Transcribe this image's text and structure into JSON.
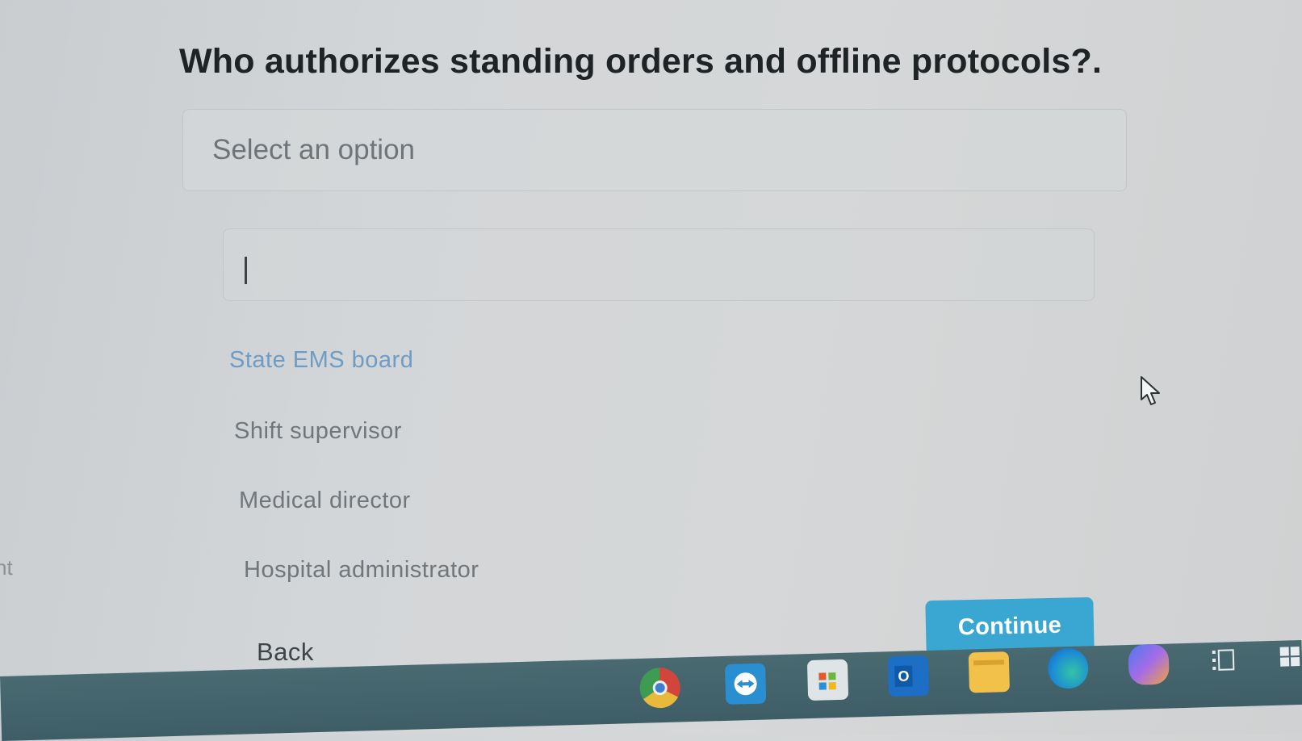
{
  "question": {
    "title": "Who authorizes standing orders and offline protocols?."
  },
  "select": {
    "placeholder": "Select an option"
  },
  "search": {
    "value": ""
  },
  "options": [
    {
      "label": "State EMS board",
      "highlighted": true
    },
    {
      "label": "Shift supervisor",
      "highlighted": false
    },
    {
      "label": "Medical director",
      "highlighted": false
    },
    {
      "label": "Hospital administrator",
      "highlighted": false
    }
  ],
  "navigation": {
    "back_label": "Back",
    "continue_label": "Continue"
  },
  "side_fragment": "nt",
  "colors": {
    "accent": "#3aa6d2",
    "highlight_option": "#6f9cc2",
    "taskbar": "#44636b"
  },
  "taskbar": {
    "icons": [
      "chrome-icon",
      "teamviewer-icon",
      "store-icon",
      "outlook-icon",
      "file-explorer-icon",
      "edge-icon",
      "copilot-icon",
      "task-view-icon",
      "windows-start-icon"
    ]
  }
}
